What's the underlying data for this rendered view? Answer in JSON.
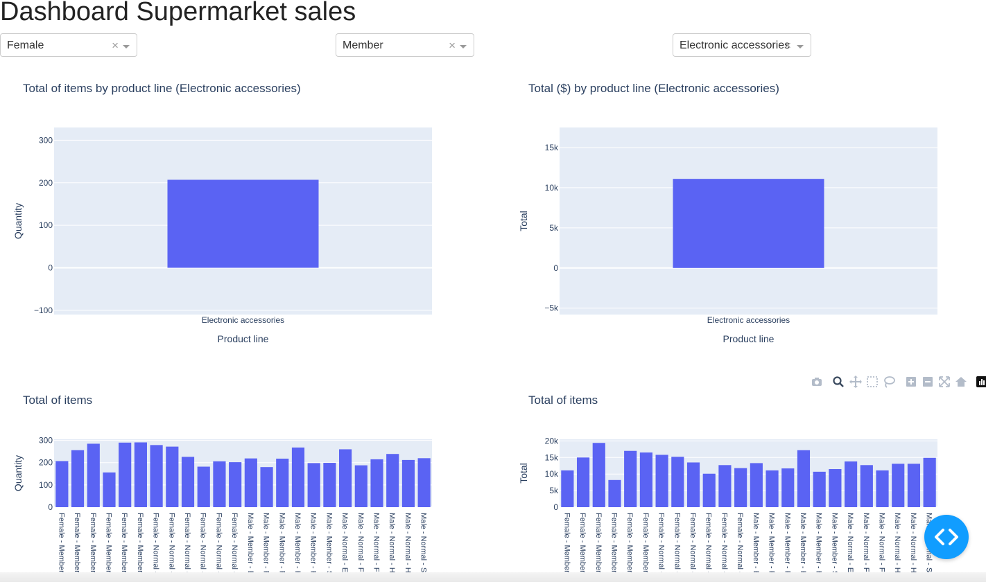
{
  "header": {
    "title": "Dashboard Supermarket sales"
  },
  "filters": {
    "gender": {
      "value": "Female",
      "clear_symbol": "×"
    },
    "customer_type": {
      "value": "Member",
      "clear_symbol": "×"
    },
    "product_line": {
      "value": "Electronic accessories",
      "clear_symbol": "×"
    }
  },
  "modebar": {
    "icons": [
      "camera-icon",
      "zoom-icon",
      "pan-icon",
      "box-select-icon",
      "lasso-icon",
      "zoom-in-icon",
      "zoom-out-icon",
      "autoscale-icon",
      "reset-axes-icon",
      "plotly-logo-icon"
    ]
  },
  "colors": {
    "bar": "#5a63f3",
    "plot_bg": "#e5ecf6",
    "font": "#2a3f5f",
    "fab": "#119dff"
  },
  "chart_data": [
    {
      "type": "bar",
      "title": "Total of items by product line (Electronic accessories)",
      "xlabel": "Product line",
      "ylabel": "Quantity",
      "categories": [
        "Electronic accessories"
      ],
      "values": [
        207
      ],
      "ylim": [
        -110,
        330
      ],
      "yticks": [
        -100,
        0,
        100,
        200,
        300
      ],
      "ytick_labels": [
        "−100",
        "0",
        "100",
        "200",
        "300"
      ],
      "grid": true
    },
    {
      "type": "bar",
      "title": "Total ($) by product line (Electronic accessories)",
      "xlabel": "Product line",
      "ylabel": "Total",
      "categories": [
        "Electronic accessories"
      ],
      "values": [
        11100
      ],
      "ylim": [
        -5800,
        17500
      ],
      "yticks": [
        -5000,
        0,
        5000,
        10000,
        15000
      ],
      "ytick_labels": [
        "−5k",
        "0",
        "5k",
        "10k",
        "15k"
      ],
      "grid": true
    },
    {
      "type": "bar",
      "title": "Total of items",
      "xlabel": "",
      "ylabel": "Quantity",
      "categories": [
        "Female - Member - E",
        "Female - Member - F",
        "Female - Member - F",
        "Female - Member - H",
        "Female - Member - H",
        "Female - Member - S",
        "Female - Normal - E",
        "Female - Normal - F",
        "Female - Normal - F",
        "Female - Normal - H",
        "Female - Normal - H",
        "Female - Normal - S",
        "Male - Member - Ele",
        "Male - Member - Fas",
        "Male - Member - Foo",
        "Male - Member - Hea",
        "Male - Member - Hom",
        "Male - Member - Spo",
        "Male - Normal - Elec",
        "Male - Normal - Fash",
        "Male - Normal - Foo",
        "Male - Normal - Hea",
        "Male - Normal - Hom",
        "Male - Normal - Spo"
      ],
      "values": [
        207,
        256,
        285,
        156,
        290,
        291,
        279,
        272,
        226,
        182,
        206,
        202,
        219,
        180,
        218,
        268,
        198,
        199,
        260,
        188,
        215,
        239,
        212,
        220
      ],
      "ylim": [
        0,
        305
      ],
      "yticks": [
        0,
        100,
        200,
        300
      ],
      "ytick_labels": [
        "0",
        "100",
        "200",
        "300"
      ],
      "grid": true
    },
    {
      "type": "bar",
      "title": "Total of items",
      "xlabel": "",
      "ylabel": "Total",
      "categories": [
        "Female - Member - E",
        "Female - Member - F",
        "Female - Member - F",
        "Female - Member - H",
        "Female - Member - H",
        "Female - Member - S",
        "Female - Normal - E",
        "Female - Normal - F",
        "Female - Normal - F",
        "Female - Normal - H",
        "Female - Normal - H",
        "Female - Normal - S",
        "Male - Member - Ele",
        "Male - Member - Fas",
        "Male - Member - Foo",
        "Male - Member - Hea",
        "Male - Member - Hom",
        "Male - Member - Spo",
        "Male - Normal - Elec",
        "Male - Normal - Fash",
        "Male - Normal - Foo",
        "Male - Normal - Hea",
        "Male - Normal - Hom",
        "Male - Normal - Spo"
      ],
      "values": [
        11100,
        15000,
        19400,
        8200,
        17000,
        16500,
        15800,
        15200,
        13500,
        10100,
        12700,
        11800,
        13300,
        11100,
        11700,
        17200,
        10700,
        11500,
        13800,
        12700,
        11100,
        13100,
        13100,
        14900
      ],
      "ylim": [
        0,
        20500
      ],
      "yticks": [
        0,
        5000,
        10000,
        15000,
        20000
      ],
      "ytick_labels": [
        "0",
        "5k",
        "10k",
        "15k",
        "20k"
      ],
      "grid": true
    }
  ]
}
